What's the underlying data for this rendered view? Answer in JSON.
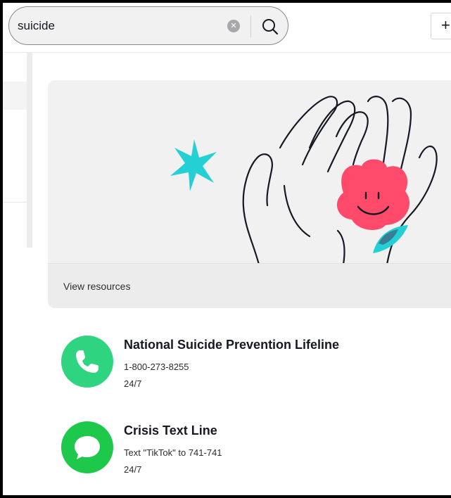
{
  "search": {
    "value": "suicide",
    "placeholder": "Search"
  },
  "banner": {
    "link_label": "View resources"
  },
  "resources": [
    {
      "title": "National Suicide Prevention Lifeline",
      "contact": "1-800-273-8255",
      "availability": "24/7",
      "icon": "phone-icon",
      "color": "#2ed47f"
    },
    {
      "title": "Crisis Text Line",
      "contact": "Text \"TikTok\" to 741-741",
      "availability": "24/7",
      "icon": "chat-bubble-icon",
      "color": "#1ec84a"
    }
  ],
  "colors": {
    "accent_pink": "#ff4a6b",
    "accent_teal": "#25d0d4"
  }
}
